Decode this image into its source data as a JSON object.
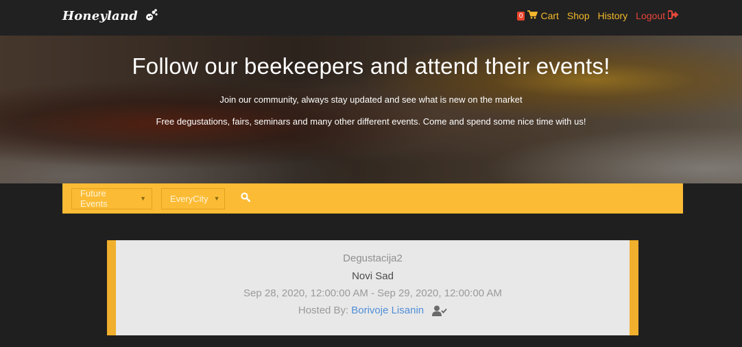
{
  "navbar": {
    "brand": "Honeyland",
    "brand_icon": "bee-icon",
    "cart_count": "0",
    "cart_label": "Cart",
    "shop_label": "Shop",
    "history_label": "History",
    "logout_label": "Logout",
    "colors": {
      "accent": "#f5b92b",
      "logout": "#e6463b",
      "badge": "#e8452c"
    }
  },
  "hero": {
    "title": "Follow our beekeepers and attend their events!",
    "subtitle": "Join our community, always stay updated and see what is new on the market",
    "description": "Free degustations, fairs, seminars and many other different events. Come and spend some nice time with us!"
  },
  "filters": {
    "event_filter": "Future Events",
    "city_filter": "EveryCity",
    "search_icon": "search-icon",
    "bar_color": "#fbbb35"
  },
  "events": [
    {
      "name": "Degustacija2",
      "city": "Novi Sad",
      "dates": "Sep 28, 2020, 12:00:00 AM - Sep 29, 2020, 12:00:00 AM",
      "hosted_by_label": "Hosted By:",
      "host": "Borivoje Lisanin",
      "host_icon": "user-check-icon"
    }
  ]
}
